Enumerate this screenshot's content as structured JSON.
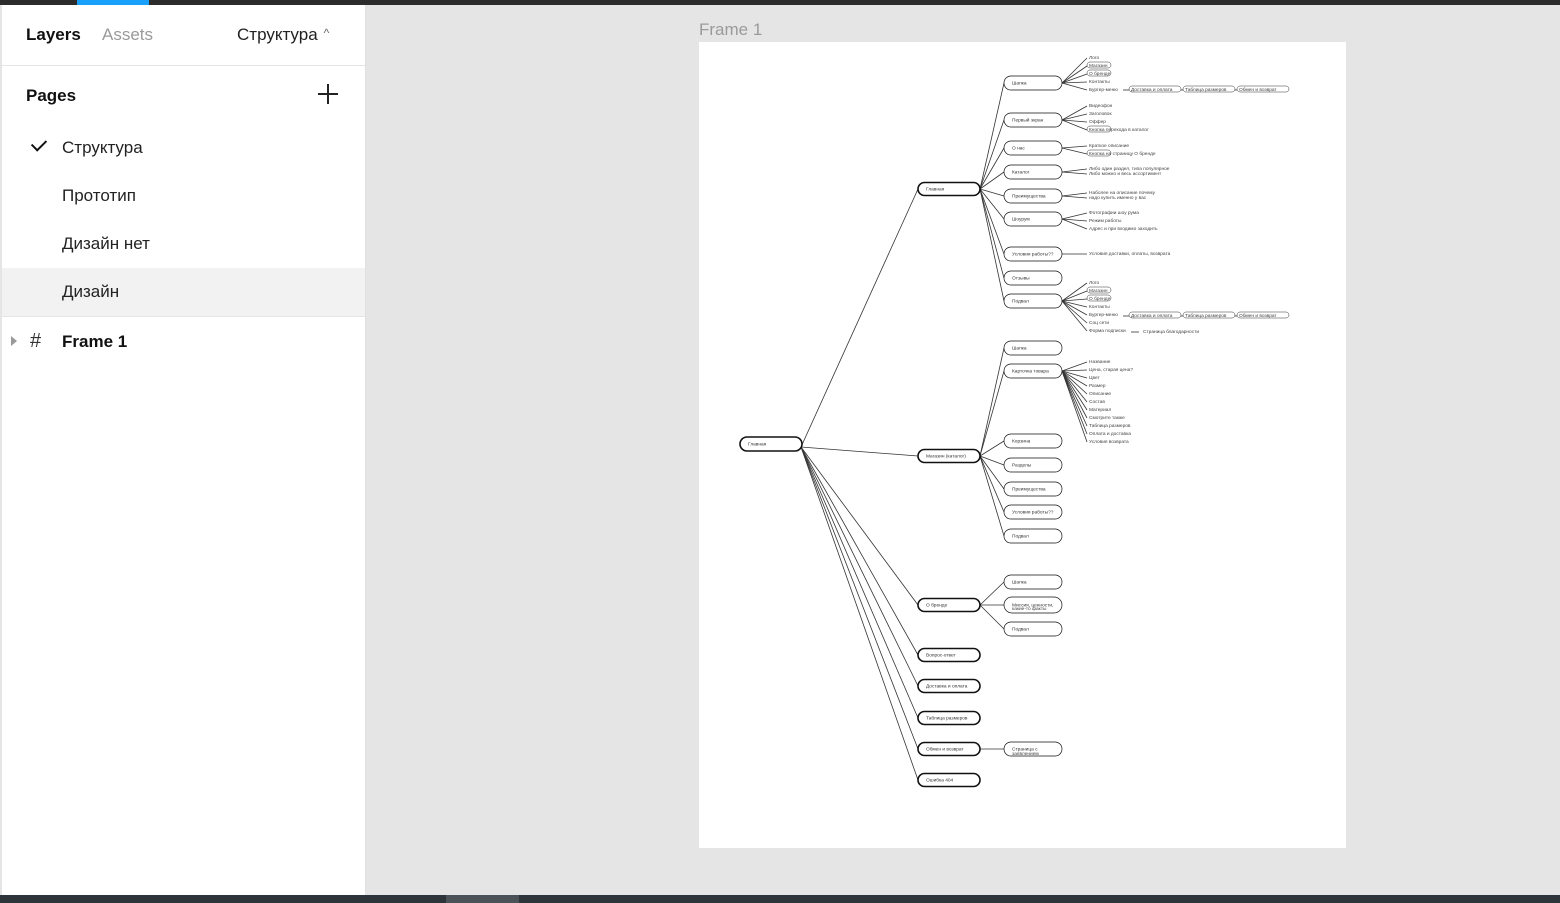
{
  "sidebar": {
    "tabs": [
      "Layers",
      "Assets"
    ],
    "current_page": "Структура",
    "pages_title": "Pages",
    "pages": [
      "Структура",
      "Прототип",
      "Дизайн нет",
      "Дизайн"
    ],
    "layers": [
      {
        "label": "Frame 1",
        "type": "frame"
      }
    ]
  },
  "canvas": {
    "frame_label": "Frame 1",
    "sitemap": {
      "root": "Главная",
      "level1": [
        "Главная",
        "Магазин (каталог)",
        "О бренде",
        "Вопрос-ответ",
        "Доставка и оплата",
        "Таблица размеров",
        "Обмен и возврат",
        "Ошибка 404"
      ],
      "home_sections": [
        "Шапка",
        "Первый экран",
        "О нас",
        "Каталог",
        "Преимущества",
        "Шоурум",
        "Условия работы??",
        "Отзывы",
        "Подвал"
      ],
      "home_header_items": [
        "Лого",
        "Магазин",
        "О бренде",
        "Контакты",
        "Бургер-меню"
      ],
      "burger_links": [
        "Доставка и оплата",
        "Таблица размеров",
        "Обмен и возврат"
      ],
      "hero_items": [
        "Видеофон",
        "Заголовок",
        "Оффер",
        "Кнопка перехода в каталог"
      ],
      "about_items": [
        "Краткое описание",
        "Кнопка на страницу О бренде"
      ],
      "catalog_items": [
        "Либо один раздел, типа популярное",
        "Либо можно и весь ассортимент"
      ],
      "advantages_items": [
        "Наболее на описание почему",
        "надо купить именно у вас"
      ],
      "showroom_items": [
        "Фотографии шоу рума",
        "Режим работы",
        "Адрес и при входимо заходить"
      ],
      "conditions_items": [
        "Условия доставки, оплаты, возврата"
      ],
      "footer_items": [
        "Лого",
        "Магазин",
        "О бренде",
        "Контакты",
        "Бургер-меню",
        "Соц сети",
        "Форма подписки"
      ],
      "footer_extra": "Страница благодарности",
      "shop_sections": [
        "Шапка",
        "Карточка товара",
        "Корзина",
        "Разделы",
        "Преимущества",
        "Условия работы??",
        "Подвал"
      ],
      "product_card_items": [
        "Название",
        "Цена, старая цена?",
        "Цвет",
        "Размер",
        "Описание",
        "Состав",
        "Материал",
        "Смотрите также",
        "Таблица размеров",
        "Оплата и доставка",
        "Условия возврата"
      ],
      "brand_sections": [
        "Шапка",
        "Миссия, ценности,",
        "какие-то факты",
        "Подвал"
      ],
      "exchange_child": [
        "Страница с",
        "заявлением"
      ]
    }
  }
}
